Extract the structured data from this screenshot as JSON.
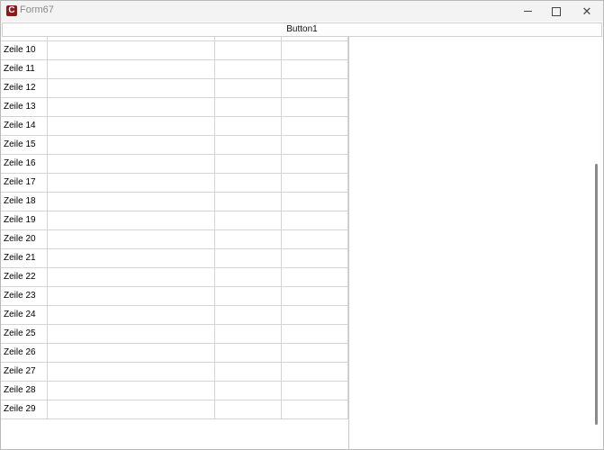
{
  "window": {
    "title": "Form67",
    "app_icon_letter": "C"
  },
  "button1": {
    "label": "Button1"
  },
  "grid": {
    "rows": [
      "Zeile 10",
      "Zeile 11",
      "Zeile 12",
      "Zeile 13",
      "Zeile 14",
      "Zeile 15",
      "Zeile 16",
      "Zeile 17",
      "Zeile 18",
      "Zeile 19",
      "Zeile 20",
      "Zeile 21",
      "Zeile 22",
      "Zeile 23",
      "Zeile 24",
      "Zeile 25",
      "Zeile 26",
      "Zeile 27",
      "Zeile 28",
      "Zeile 29"
    ]
  },
  "icons": {
    "minimize": "minimize-icon",
    "maximize": "maximize-icon",
    "close": "close-icon"
  },
  "colors": {
    "app_icon": "#8b1a1a",
    "titlebar": "#f3f3f3",
    "grid_line": "#d4d4d4"
  }
}
